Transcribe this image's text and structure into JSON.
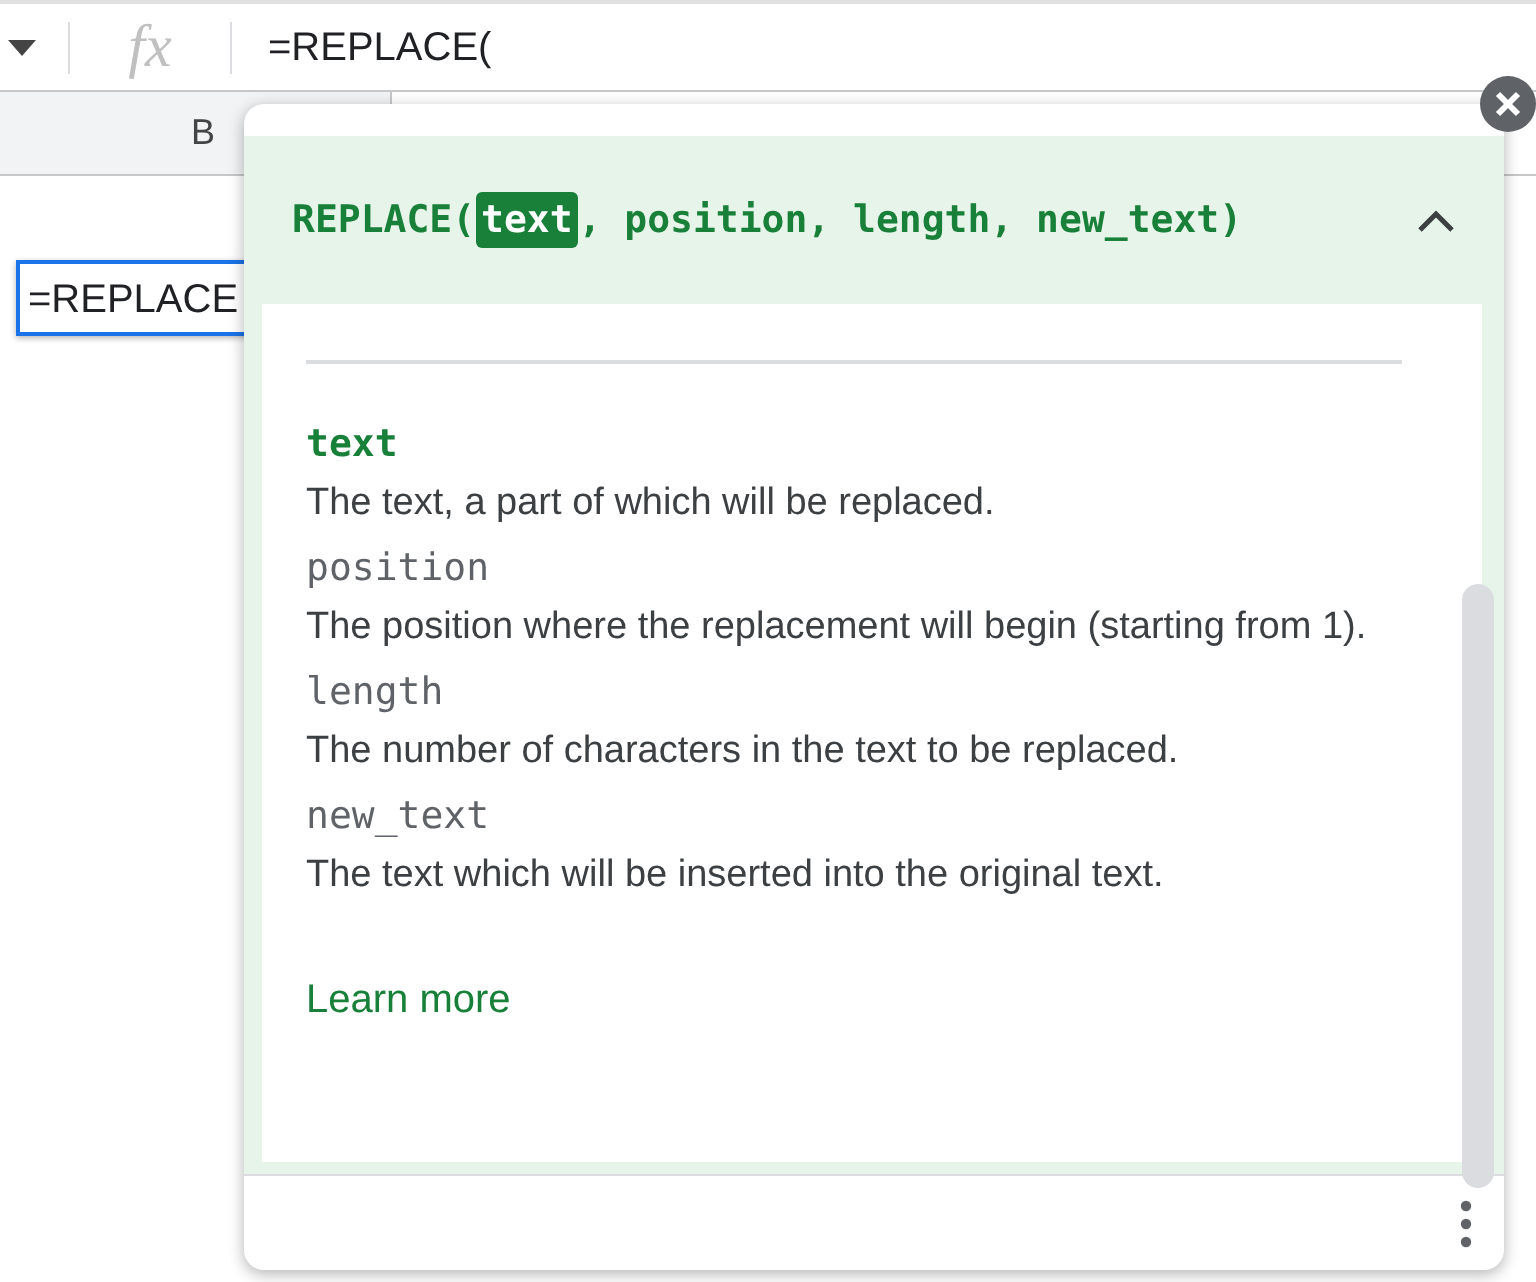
{
  "formula_bar": {
    "label": "fx",
    "formula": "=REPLACE("
  },
  "column_headers": [
    "B"
  ],
  "active_cell": {
    "value": "=REPLACE"
  },
  "help_popup": {
    "signature": [
      {
        "text": "REPLACE(",
        "selected": false
      },
      {
        "text": "text",
        "selected": true
      },
      {
        "text": ", position, length, new_text)",
        "selected": false
      }
    ],
    "expanded": true,
    "params": [
      {
        "name": "text",
        "selected": true,
        "description": "The text, a part of which will be replaced."
      },
      {
        "name": "position",
        "selected": false,
        "description": "The position where the replacement will begin (starting from 1)."
      },
      {
        "name": "length",
        "selected": false,
        "description": "The number of characters in the text to be replaced."
      },
      {
        "name": "new_text",
        "selected": false,
        "description": "The text which will be inserted into the original text."
      }
    ],
    "link": "Learn more"
  }
}
